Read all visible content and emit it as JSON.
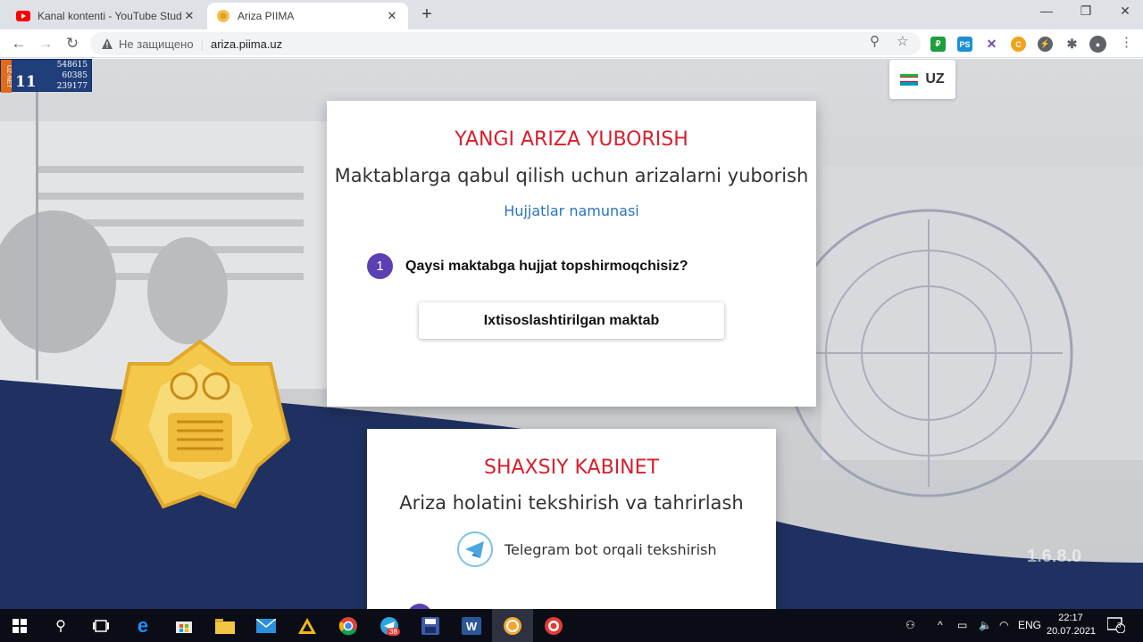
{
  "browser": {
    "tabs": [
      {
        "title": "Kanal kontenti - YouTube Studio",
        "active": false
      },
      {
        "title": "Ariza PIIMA",
        "active": true
      }
    ],
    "new_tab_icon": "plus-icon",
    "window_controls": [
      "minimize-icon",
      "maximize-icon",
      "close-icon"
    ],
    "security_text": "Не защищено",
    "url": "ariza.piima.uz"
  },
  "page": {
    "counter": {
      "label": "UZ-NET",
      "today": "11",
      "values": [
        "548615",
        "60385",
        "239177"
      ]
    },
    "language": {
      "code": "UZ",
      "flag_colors": [
        "#1eb53a",
        "#ffffff",
        "#0099b5"
      ]
    },
    "application_card": {
      "heading": "YANGI ARIZA YUBORISH",
      "subheading": "Maktablarga qabul qilish uchun arizalarni yuborish",
      "sample_link": "Hujjatlar namunasi",
      "step_number": "1",
      "step_question": "Qaysi maktabga hujjat topshirmoqchisiz?",
      "choice_button": "Ixtisoslashtirilgan maktab"
    },
    "cabinet_card": {
      "heading": "SHAXSIY KABINET",
      "subheading": "Ariza holatini tekshirish va tahrirlash",
      "telegram_link": "Telegram bot orqali tekshirish"
    },
    "version": "1.6.8.0"
  },
  "taskbar": {
    "apps": [
      "windows-start",
      "search",
      "task-view",
      "edge",
      "store",
      "file-explorer",
      "mail",
      "app-triangle",
      "chrome",
      "telegram",
      "save-app",
      "word",
      "coin-app",
      "record-app"
    ],
    "telegram_badge": "38",
    "language": "ENG",
    "time": "22:17",
    "date": "20.07.2021",
    "notifications": "3"
  },
  "colors": {
    "heading_red": "#d71f2b",
    "accent_purple": "#5b3fb3",
    "link_blue": "#2a73c5",
    "navy": "#1f3161"
  }
}
